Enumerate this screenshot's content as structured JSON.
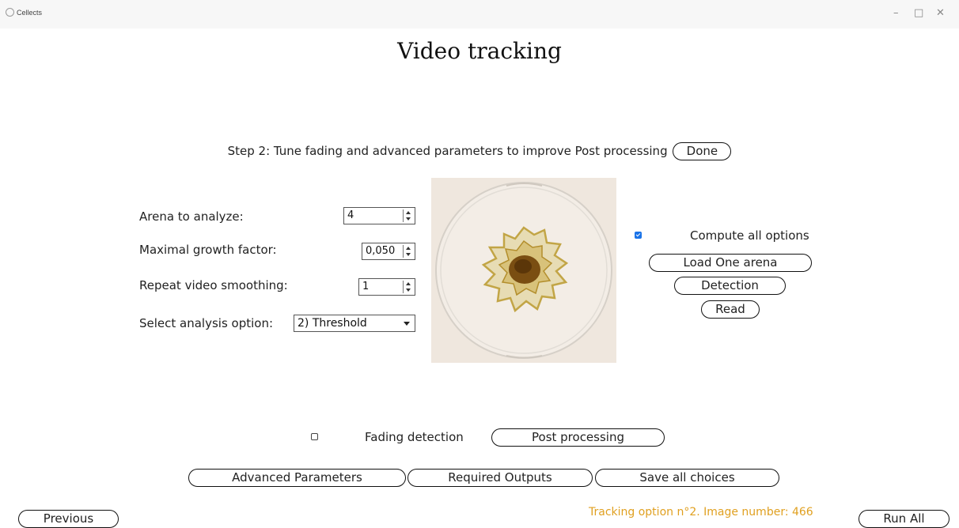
{
  "window": {
    "app_name": "Cellects",
    "controls": {
      "minimize": "–",
      "maximize": "□",
      "close": "✕"
    }
  },
  "page": {
    "title": "Video tracking"
  },
  "step": {
    "text": "Step 2: Tune fading and advanced parameters to improve Post processing",
    "done_label": "Done"
  },
  "params": {
    "arena_label": "Arena to analyze:",
    "arena_value": "4",
    "growth_label": "Maximal growth factor:",
    "growth_value": "0,050",
    "smoothing_label": "Repeat video smoothing:",
    "smoothing_value": "1",
    "analysis_label": "Select analysis option:",
    "analysis_value": "2) Threshold"
  },
  "right_panel": {
    "compute_all_label": "Compute all options",
    "compute_all_checked": true,
    "load_one_arena_label": "Load One arena",
    "detection_label": "Detection",
    "read_label": "Read"
  },
  "bottom": {
    "fading_label": "Fading detection",
    "fading_checked": false,
    "post_processing_label": "Post processing",
    "advanced_label": "Advanced Parameters",
    "required_outputs_label": "Required Outputs",
    "save_all_label": "Save all choices",
    "previous_label": "Previous",
    "status_text": "Tracking option n°2. Image number: 466",
    "run_all_label": "Run All"
  },
  "colors": {
    "accent": "#1a73e8",
    "status": "#e0a020"
  },
  "icons": [
    "cellects-app-icon",
    "minimize-icon",
    "maximize-icon",
    "close-icon",
    "spin-arrows-icon",
    "dropdown-caret-icon",
    "checkbox-icon"
  ]
}
